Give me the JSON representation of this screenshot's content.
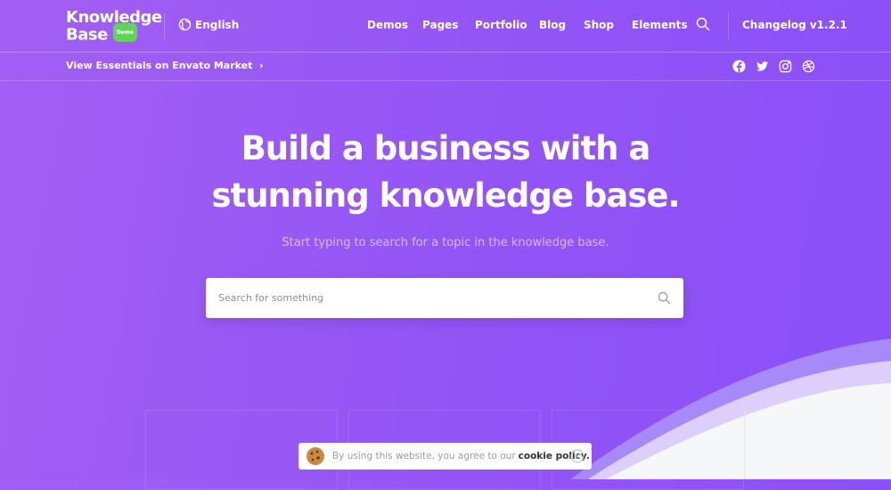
{
  "header": {
    "logo_line1": "Knowledge",
    "logo_line2": "Base",
    "logo_badge": "Demo",
    "language": "English",
    "nav": [
      "Demos",
      "Pages",
      "Portfolio",
      "Blog",
      "Shop",
      "Elements"
    ],
    "changelog": "Changelog v1.2.1"
  },
  "subbar": {
    "envato_link": "View Essentials on Envato Market",
    "social": [
      "facebook",
      "twitter",
      "instagram",
      "dribbble"
    ]
  },
  "hero": {
    "title_line1": "Build a business with a",
    "title_line2": "stunning knowledge base.",
    "subtitle": "Start typing to search for a topic in the knowledge base.",
    "search_placeholder": "Search for something"
  },
  "cookie": {
    "text": "By using this website, you agree to our",
    "link": "cookie policy."
  },
  "colors": {
    "accent": "#8a4ff8",
    "badge": "#5fd35a"
  }
}
